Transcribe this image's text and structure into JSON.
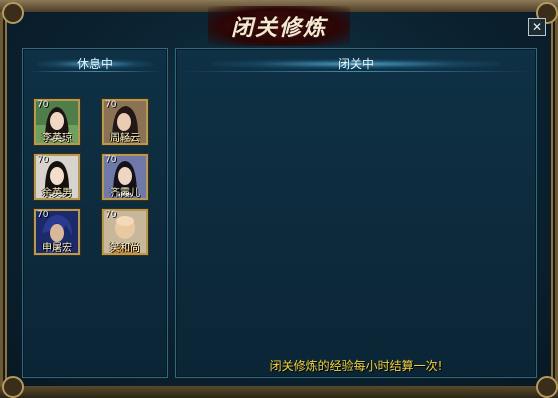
{
  "window": {
    "title": "闭关修炼",
    "close_symbol": "✕"
  },
  "rest_panel": {
    "title": "休息中",
    "heroes": [
      {
        "name": "李英琼",
        "level": "70",
        "icon": "woman-portrait-icon"
      },
      {
        "name": "周轻云",
        "level": "70",
        "icon": "woman-portrait-icon"
      },
      {
        "name": "余英男",
        "level": "70",
        "icon": "woman-portrait-icon"
      },
      {
        "name": "齐霞儿",
        "level": "70",
        "icon": "woman-portrait-icon"
      },
      {
        "name": "申屠宏",
        "level": "70",
        "icon": "man-portrait-icon"
      },
      {
        "name": "笑和尚",
        "level": "70",
        "icon": "monk-portrait-icon"
      }
    ]
  },
  "training_panel": {
    "title": "闭关中",
    "note": "闭关修炼的经验每小时结算一次!"
  },
  "colors": {
    "accent_gold": "#b59a55",
    "note_yellow": "#f3d23c",
    "panel_border": "#2f6a80"
  }
}
